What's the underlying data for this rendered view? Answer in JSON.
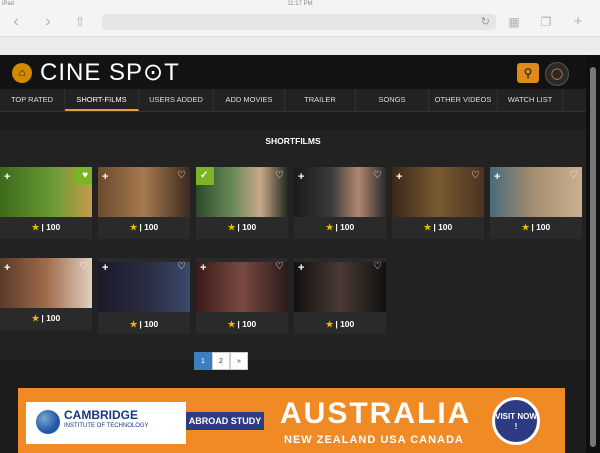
{
  "browser": {
    "time": "11:17 PM",
    "carrier": "iPad"
  },
  "site": {
    "logo": "CINE SP⊙T",
    "menu": [
      {
        "label": "TOP RATED",
        "active": false
      },
      {
        "label": "SHORT-FILMS",
        "active": true
      },
      {
        "label": "USERS ADDED",
        "active": false
      },
      {
        "label": "ADD MOVIES",
        "active": false
      },
      {
        "label": "TRAILER",
        "active": false
      },
      {
        "label": "SONGS",
        "active": false
      },
      {
        "label": "OTHER VIDEOS",
        "active": false
      },
      {
        "label": "WATCH LIST",
        "active": false
      }
    ],
    "section_title": "SHORTFILMS",
    "cards": [
      {
        "rating": "| 100"
      },
      {
        "rating": "| 100"
      },
      {
        "rating": "| 100"
      },
      {
        "rating": "| 100"
      },
      {
        "rating": "| 100"
      },
      {
        "rating": "| 100"
      },
      {
        "rating": "| 100"
      },
      {
        "rating": "| 100"
      },
      {
        "rating": "| 100"
      },
      {
        "rating": "| 100"
      }
    ],
    "pagination": {
      "pages": [
        "1",
        "2",
        "»"
      ],
      "current": "1"
    },
    "banner": {
      "brand": "CAMBRIDGE",
      "brand_sub": "INSTITUTE OF TECHNOLOGY",
      "abroad": "ABROAD STUDY",
      "headline": "AUSTRALIA",
      "countries": "NEW ZEALAND    USA    CANADA",
      "cta": "VISIT NOW !"
    }
  }
}
